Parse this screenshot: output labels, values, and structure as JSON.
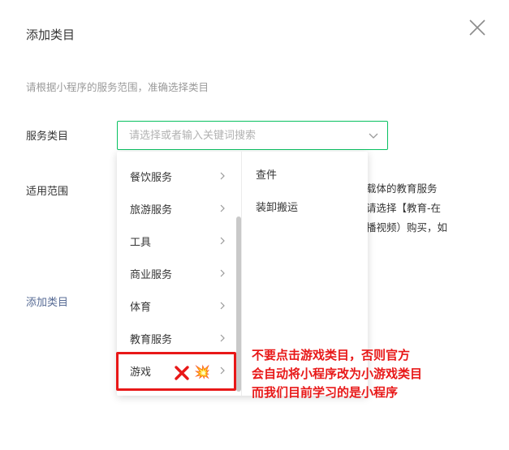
{
  "dialog": {
    "title": "添加类目",
    "hint": "请根据小程序的服务范围，准确选择类目",
    "service_label": "服务类目",
    "scope_label": "适用范围",
    "add_link": "添加类目",
    "search_placeholder": "请选择或者输入关键词搜索",
    "scope_lines": [
      "网为载体的教育服务",
      "务，请选择【教育-在",
      "如录播视频）购买，如"
    ]
  },
  "dropdown": {
    "level1": [
      "餐饮服务",
      "旅游服务",
      "工具",
      "商业服务",
      "体育",
      "教育服务",
      "游戏"
    ],
    "level2": [
      "查件",
      "装卸搬运"
    ]
  },
  "annotation": {
    "lines": [
      "不要点击游戏类目，否则官方",
      "会自动将小程序改为小游戏类目",
      "而我们目前学习的是小程序"
    ],
    "emoji": "💥"
  },
  "colors": {
    "accent": "#07c160",
    "link": "#576b95",
    "annotation": "#e81818"
  },
  "icons": [
    "close-icon",
    "chevron-down-icon",
    "chevron-right-icon",
    "cross-mark-icon",
    "explosion-icon"
  ]
}
